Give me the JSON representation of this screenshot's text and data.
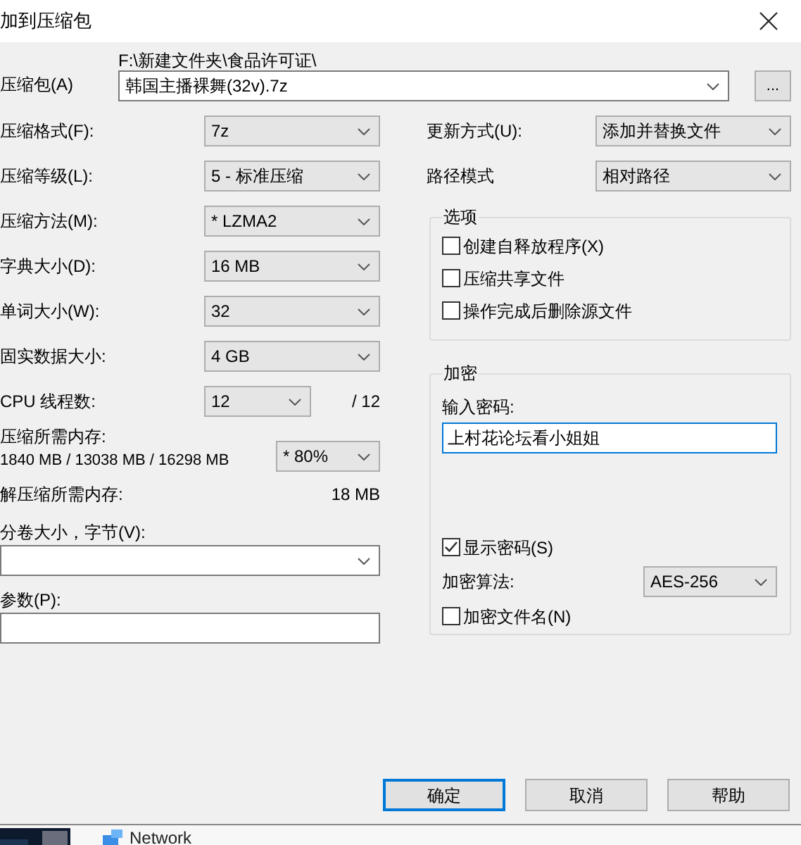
{
  "window": {
    "title": "加到压缩包"
  },
  "archive": {
    "label": "压缩包(A)",
    "path": "F:\\新建文件夹\\食品许可证\\",
    "filename": "韩国主播裸舞(32v).7z",
    "browse": "..."
  },
  "settings": [
    {
      "label": "压缩格式(F):",
      "value": "7z"
    },
    {
      "label": "压缩等级(L):",
      "value": "5 - 标准压缩"
    },
    {
      "label": "压缩方法(M):",
      "value": "*  LZMA2"
    },
    {
      "label": "字典大小(D):",
      "value": "16 MB"
    },
    {
      "label": "单词大小(W):",
      "value": "32"
    },
    {
      "label": "固实数据大小:",
      "value": "4 GB"
    }
  ],
  "threads": {
    "label": "CPU 线程数:",
    "value": "12",
    "total": "/ 12"
  },
  "compress_memory": {
    "label": "压缩所需内存:",
    "usage": "1840 MB / 13038 MB / 16298 MB",
    "value": "* 80%"
  },
  "decompress_memory": {
    "label": "解压缩所需内存:",
    "value": "18 MB"
  },
  "split": {
    "label": "分卷大小，字节(V):"
  },
  "parameters": {
    "label": "参数(P):"
  },
  "update_mode": {
    "label": "更新方式(U):",
    "value": "添加并替换文件"
  },
  "path_mode": {
    "label": "路径模式",
    "value": "相对路径"
  },
  "options": {
    "title": "选项",
    "items": [
      {
        "label": "创建自释放程序(X)",
        "checked": false
      },
      {
        "label": "压缩共享文件",
        "checked": false
      },
      {
        "label": "操作完成后删除源文件",
        "checked": false
      }
    ]
  },
  "encryption": {
    "title": "加密",
    "password_label": "输入密码:",
    "password": "上村花论坛看小姐姐",
    "show_password": {
      "label": "显示密码(S)",
      "checked": true
    },
    "method": {
      "label": "加密算法:",
      "value": "AES-256"
    },
    "encrypt_names": {
      "label": "加密文件名(N)",
      "checked": false
    }
  },
  "buttons": [
    {
      "label": "确定",
      "focused": true
    },
    {
      "label": "取消",
      "focused": false
    },
    {
      "label": "帮助",
      "focused": false
    }
  ],
  "background": {
    "label": "Network"
  }
}
